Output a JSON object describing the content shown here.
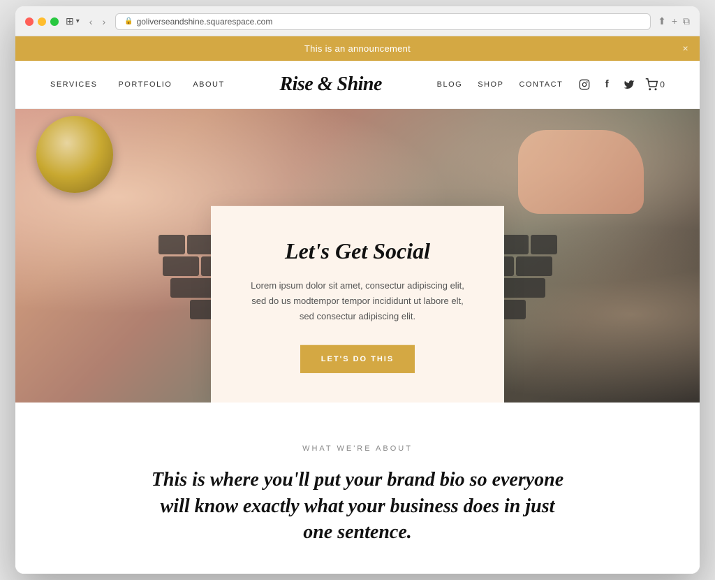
{
  "browser": {
    "url": "goliverseandshine.squarespace.com",
    "back_label": "‹",
    "forward_label": "›"
  },
  "announcement": {
    "text": "This is an announcement",
    "close_label": "×"
  },
  "nav": {
    "logo": "Rise & Shine",
    "left_links": [
      {
        "label": "SERVICES",
        "id": "services"
      },
      {
        "label": "PORTFOLIO",
        "id": "portfolio"
      },
      {
        "label": "ABOUT",
        "id": "about"
      }
    ],
    "right_links": [
      {
        "label": "BLOG",
        "id": "blog"
      },
      {
        "label": "SHOP",
        "id": "shop"
      },
      {
        "label": "CONTACT",
        "id": "contact"
      }
    ],
    "cart_count": "0"
  },
  "hero": {
    "card": {
      "title": "Let's Get Social",
      "text": "Lorem ipsum dolor sit amet, consectur adipiscing elit, sed do us modtempor tempor incididunt ut labore elt, sed consectur adipiscing elit.",
      "button_label": "LET'S DO THIS"
    }
  },
  "about": {
    "eyebrow": "WHAT WE'RE ABOUT",
    "title": "This is where you'll put your brand bio so everyone will know exactly what your business does in just one sentence."
  },
  "colors": {
    "announcement_bg": "#d4a843",
    "card_bg": "#fdf4ec",
    "button_bg": "#d4a843",
    "accent": "#d4a843"
  }
}
